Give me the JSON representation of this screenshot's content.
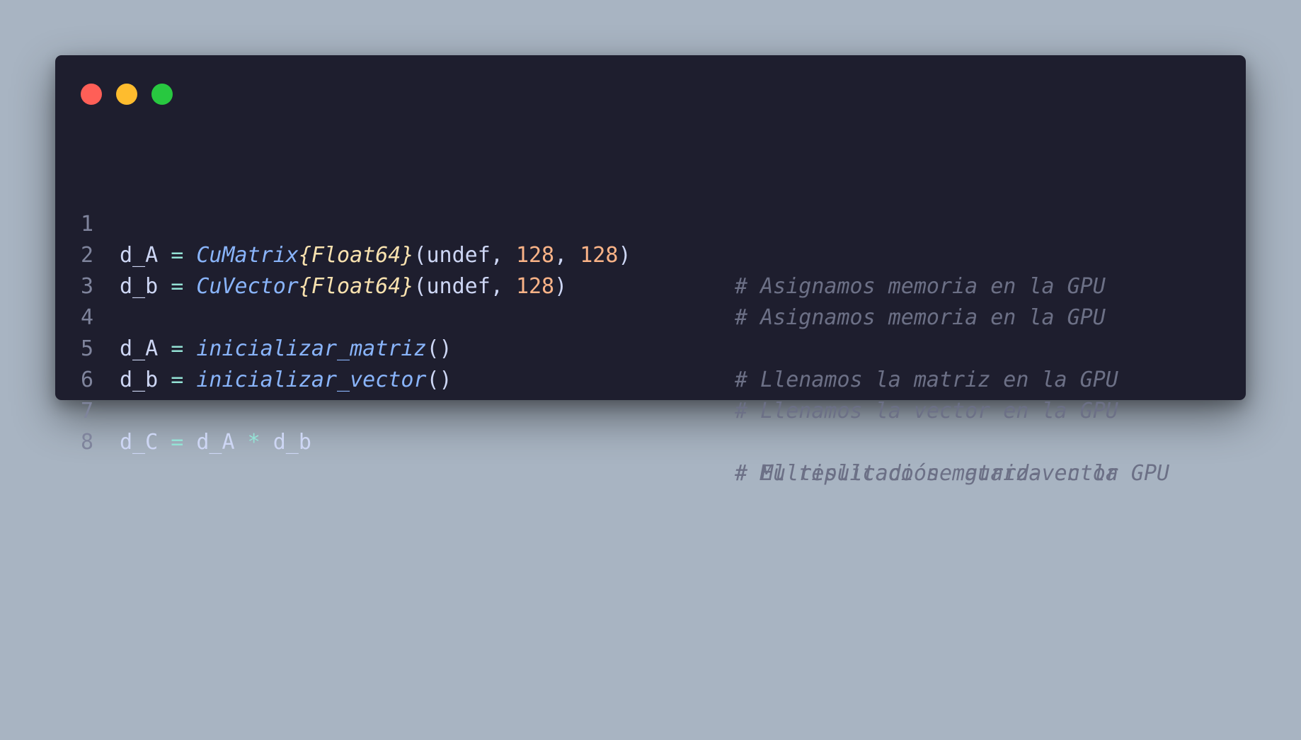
{
  "window": {
    "buttons": [
      "close",
      "minimize",
      "maximize"
    ],
    "colors": {
      "background": "#1e1e2e",
      "close": "#ff5f57",
      "minimize": "#febc2e",
      "maximize": "#28c840",
      "comment": "#6c7086",
      "type": "#89b4fa",
      "type_param": "#f9e2af",
      "number": "#fab387",
      "operator": "#94e2d5",
      "text": "#cdd6f4",
      "line_number": "#7f849c"
    }
  },
  "code": {
    "lines": [
      {
        "number": "1",
        "tokens": {
          "var": "d_A",
          "eq": "=",
          "type": "CuMatrix",
          "param": "{Float64}",
          "open": "(",
          "arg1": "undef",
          "sep1": ", ",
          "n1": "128",
          "sep2": ", ",
          "n2": "128",
          "close": ")"
        },
        "comment": "# Asignamos memoria en la GPU"
      },
      {
        "number": "2",
        "tokens": {
          "var": "d_b",
          "eq": "=",
          "type": "CuVector",
          "param": "{Float64}",
          "open": "(",
          "arg1": "undef",
          "sep1": ", ",
          "n1": "128",
          "close": ")"
        },
        "comment": "# Asignamos memoria en la GPU"
      },
      {
        "number": "3"
      },
      {
        "number": "4",
        "tokens": {
          "var": "d_A",
          "eq": "=",
          "fn": "inicializar_matriz",
          "call": "()"
        },
        "comment": "# Llenamos la matriz en la GPU"
      },
      {
        "number": "5",
        "tokens": {
          "var": "d_b",
          "eq": "=",
          "fn": "inicializar_vector",
          "call": "()"
        },
        "comment": "# Llenamos la vector en la GPU"
      },
      {
        "number": "6"
      },
      {
        "number": "7",
        "tokens": {
          "var": "d_C",
          "eq": "=",
          "lhs": "d_A",
          "mul": "*",
          "rhs": "d_b"
        },
        "comment": "# Multiplicación matriz-vector"
      },
      {
        "number": "8",
        "comment": "# El resultado se guarda en la GPU"
      }
    ]
  }
}
